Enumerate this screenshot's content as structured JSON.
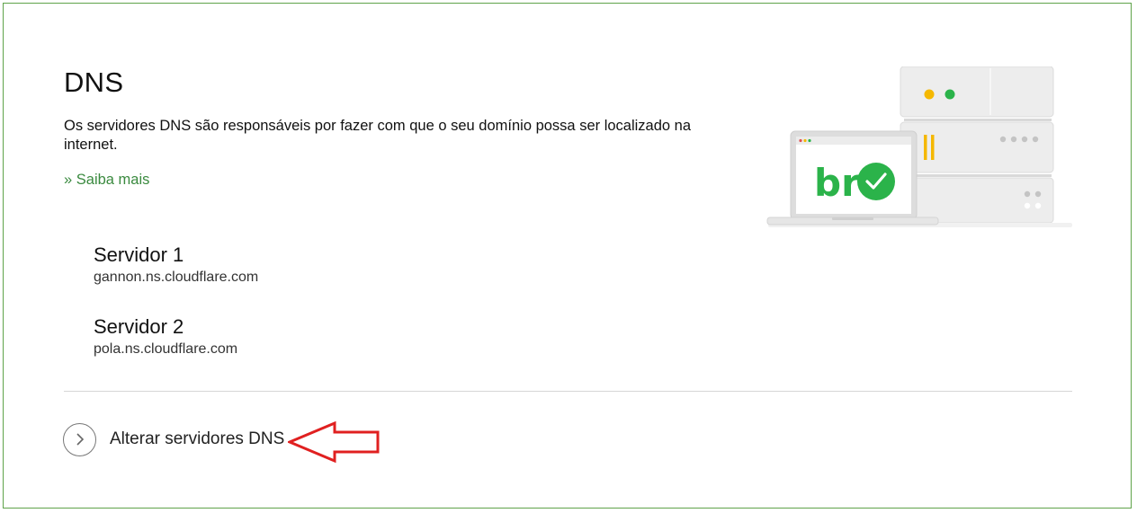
{
  "section": {
    "title": "DNS",
    "description": "Os servidores DNS são responsáveis por fazer com que o seu domínio possa ser localizado na internet.",
    "learn_more": "» Saiba mais"
  },
  "servers": [
    {
      "name": "Servidor 1",
      "host": "gannon.ns.cloudflare.com"
    },
    {
      "name": "Servidor 2",
      "host": "pola.ns.cloudflare.com"
    }
  ],
  "action": {
    "label": "Alterar servidores DNS",
    "icon": "chevron-right-icon"
  },
  "illustration": {
    "logo_text": "br",
    "icon": "check-icon"
  },
  "colors": {
    "border": "#5fa34a",
    "link": "#3a8a3f",
    "accent_green": "#2bb34a",
    "accent_yellow": "#f5b800",
    "annotation_arrow": "#e02020"
  }
}
